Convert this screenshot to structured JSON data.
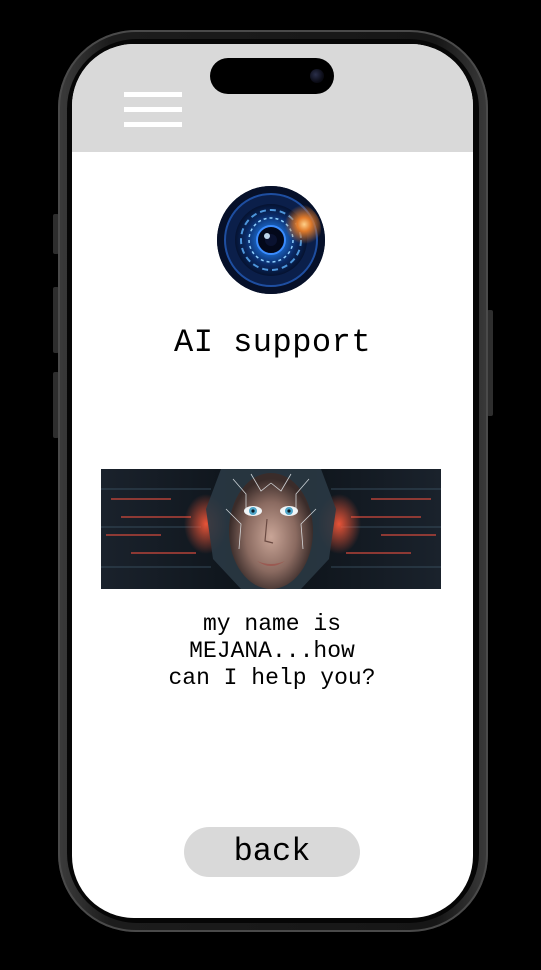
{
  "header": {
    "menu_icon": "hamburger-menu-icon"
  },
  "profile": {
    "avatar_image": "ai-eye-lens-avatar",
    "title": "AI support"
  },
  "banner": {
    "image": "ai-android-face-circuit-banner"
  },
  "chat": {
    "message": "my name is MEJANA...how can I help you?"
  },
  "actions": {
    "back_label": "back"
  }
}
